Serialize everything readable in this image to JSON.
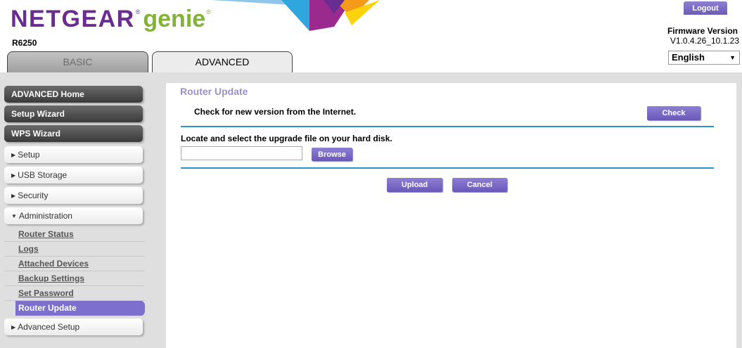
{
  "header": {
    "logo_netgear": "NETGEAR",
    "logo_genie": "genie",
    "logo_reg": "®",
    "model": "R6250",
    "logout_label": "Logout",
    "firmware_label": "Firmware Version",
    "firmware_version": "V1.0.4.26_10.1.23",
    "language_selected": "English"
  },
  "tabs": [
    {
      "label": "BASIC",
      "active": false
    },
    {
      "label": "ADVANCED",
      "active": true
    }
  ],
  "sidebar": {
    "top_items": [
      "ADVANCED Home",
      "Setup Wizard",
      "WPS Wizard"
    ],
    "sections": [
      "Setup",
      "USB Storage",
      "Security",
      "Administration"
    ],
    "admin_items": [
      "Router Status",
      "Logs",
      "Attached Devices",
      "Backup Settings",
      "Set Password",
      "Router Update"
    ],
    "bottom_section": "Advanced Setup"
  },
  "main": {
    "title": "Router Update",
    "check_text": "Check for new version from the Internet.",
    "check_label": "Check",
    "locate_text": "Locate and select the upgrade file on your hard disk.",
    "file_value": "",
    "browse_label": "Browse",
    "upload_label": "Upload",
    "cancel_label": "Cancel"
  },
  "colors": {
    "brand_purple": "#6b2c91",
    "brand_green": "#82b336",
    "button_purple": "#7d6fcd",
    "divider_blue": "#2a93c7"
  }
}
